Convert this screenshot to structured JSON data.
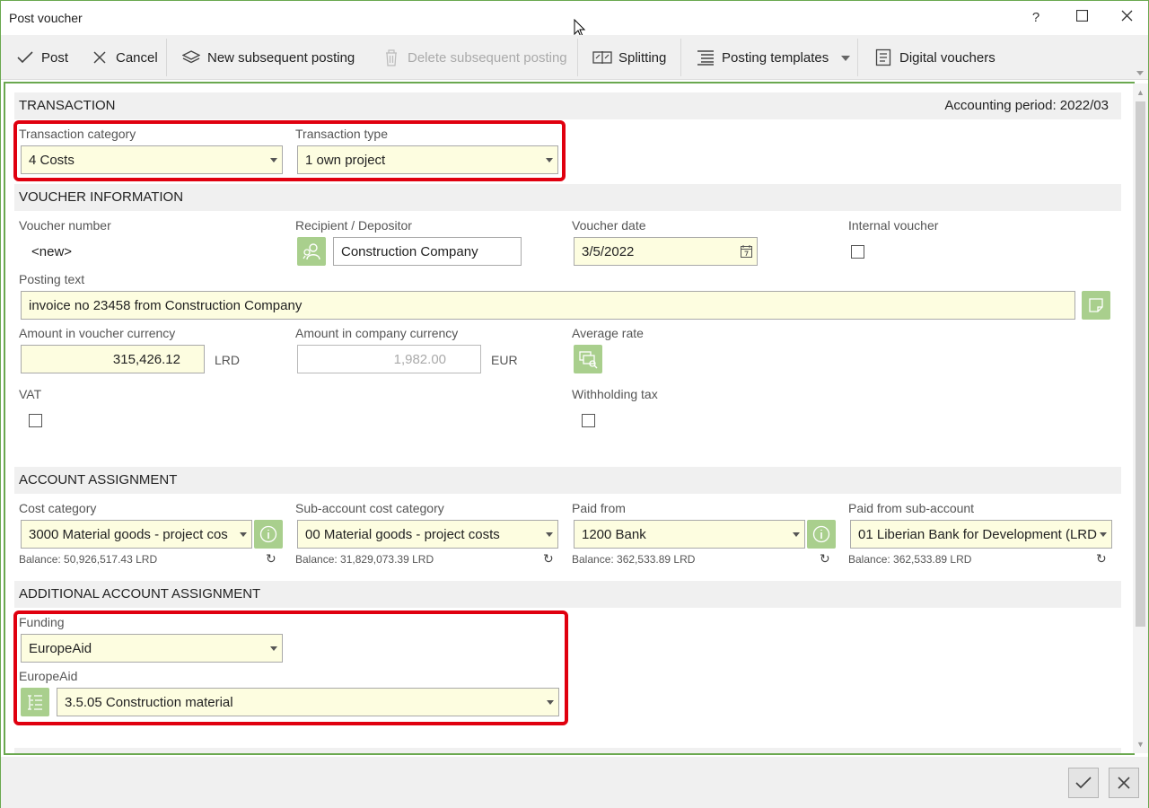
{
  "window": {
    "title": "Post voucher",
    "help": "?"
  },
  "toolbar": {
    "post": "Post",
    "cancel": "Cancel",
    "new_subsequent": "New subsequent posting",
    "delete_subsequent": "Delete subsequent posting",
    "splitting": "Splitting",
    "posting_templates": "Posting templates",
    "digital_vouchers": "Digital vouchers"
  },
  "transaction": {
    "heading": "TRANSACTION",
    "accounting_period": "Accounting period: 2022/03",
    "category_label": "Transaction category",
    "category_value": "4 Costs",
    "type_label": "Transaction type",
    "type_value": "1 own project"
  },
  "voucher": {
    "heading": "VOUCHER INFORMATION",
    "number_label": "Voucher number",
    "number_value": "<new>",
    "recipient_label": "Recipient / Depositor",
    "recipient_value": "Construction Company",
    "date_label": "Voucher date",
    "date_value": "3/5/2022",
    "internal_label": "Internal voucher",
    "internal_checked": false,
    "posting_text_label": "Posting text",
    "posting_text_value": "invoice no 23458 from Construction Company",
    "amount_label": "Amount in voucher currency",
    "amount_value": "315,426.12",
    "amount_currency": "LRD",
    "company_amount_label": "Amount in company currency",
    "company_amount_value": "1,982.00",
    "company_currency": "EUR",
    "avg_rate_label": "Average rate",
    "vat_label": "VAT",
    "vat_checked": false,
    "withholding_label": "Withholding tax",
    "withholding_checked": false
  },
  "account": {
    "heading": "ACCOUNT ASSIGNMENT",
    "cost_category_label": "Cost category",
    "cost_category_value": "3000 Material goods - project cos",
    "cost_category_balance": "Balance: 50,926,517.43 LRD",
    "sub_cost_label": "Sub-account cost category",
    "sub_cost_value": "00 Material goods - project costs",
    "sub_cost_balance": "Balance: 31,829,073.39 LRD",
    "paid_from_label": "Paid from",
    "paid_from_value": "1200 Bank",
    "paid_from_balance": "Balance: 362,533.89 LRD",
    "paid_sub_label": "Paid from sub-account",
    "paid_sub_value": "01 Liberian Bank for Development (LRD",
    "paid_sub_balance": "Balance: 362,533.89 LRD"
  },
  "additional": {
    "heading": "ADDITIONAL ACCOUNT ASSIGNMENT",
    "funding_label": "Funding",
    "funding_value": "EuropeAid",
    "europeaid_label": "EuropeAid",
    "europeaid_value": "3.5.05 Construction material"
  },
  "colors": {
    "accent_green": "#6aa84f",
    "button_green": "#a9cf8d",
    "field_yellow": "#fdfde0",
    "highlight_red": "#e0000f"
  }
}
